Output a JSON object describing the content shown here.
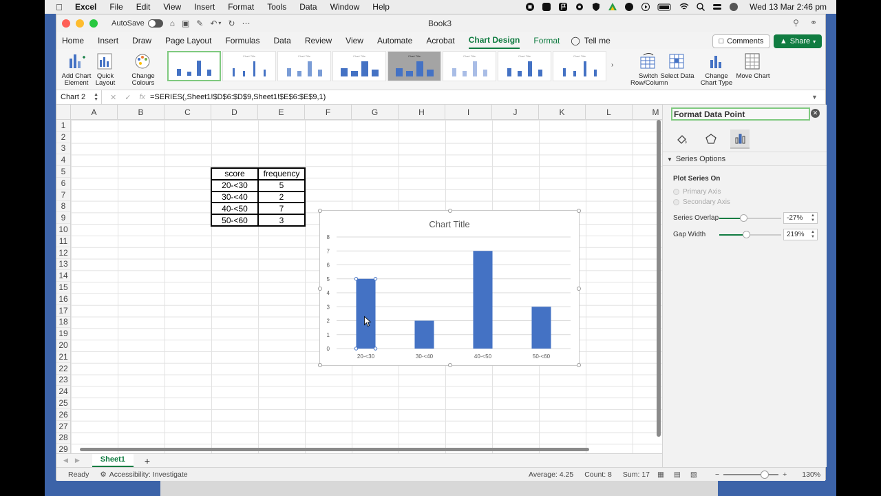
{
  "menubar": {
    "app": "Excel",
    "items": [
      "File",
      "Edit",
      "View",
      "Insert",
      "Format",
      "Tools",
      "Data",
      "Window",
      "Help"
    ],
    "clock": "Wed 13 Mar  2:46 pm"
  },
  "titlebar": {
    "autosave_label": "AutoSave",
    "doc_title": "Book3"
  },
  "tabs": [
    "Home",
    "Insert",
    "Draw",
    "Page Layout",
    "Formulas",
    "Data",
    "Review",
    "View",
    "Automate",
    "Acrobat",
    "Chart Design",
    "Format"
  ],
  "active_tab": "Chart Design",
  "tell_me": "Tell me",
  "comments_label": "Comments",
  "share_label": "Share",
  "ribbon": {
    "add_chart_element": "Add Chart Element",
    "quick_layout": "Quick Layout",
    "change_colours": "Change Colours",
    "switch_row_column": "Switch Row/Column",
    "select_data": "Select Data",
    "change_chart_type": "Change Chart Type",
    "move_chart": "Move Chart"
  },
  "formula_bar": {
    "name_box": "Chart 2",
    "formula": "=SERIES(,Sheet1!$D$6:$D$9,Sheet1!$E$6:$E$9,1)"
  },
  "columns": [
    "A",
    "B",
    "C",
    "D",
    "E",
    "F",
    "G",
    "H",
    "I",
    "J",
    "K",
    "L",
    "M"
  ],
  "rows": [
    "1",
    "2",
    "3",
    "4",
    "5",
    "6",
    "7",
    "8",
    "9",
    "10",
    "11",
    "12",
    "13",
    "14",
    "15",
    "16",
    "17",
    "18",
    "19",
    "20",
    "21",
    "22",
    "23",
    "24",
    "25",
    "26",
    "27",
    "28",
    "29"
  ],
  "table": {
    "headers": [
      "score",
      "frequency"
    ],
    "rows": [
      [
        "20-<30",
        "5"
      ],
      [
        "30-<40",
        "2"
      ],
      [
        "40-<50",
        "7"
      ],
      [
        "50-<60",
        "3"
      ]
    ]
  },
  "chart_data": {
    "type": "bar",
    "title": "Chart Title",
    "categories": [
      "20-<30",
      "30-<40",
      "40-<50",
      "50-<60"
    ],
    "values": [
      5,
      2,
      7,
      3
    ],
    "ylim": [
      0,
      8
    ],
    "yticks": [
      "0",
      "1",
      "2",
      "3",
      "4",
      "5",
      "6",
      "7",
      "8"
    ],
    "color": "#4472c4",
    "grid": true,
    "selected_index": 0
  },
  "sheet_tab": "Sheet1",
  "status": {
    "ready": "Ready",
    "accessibility": "Accessibility: Investigate",
    "average": "Average: 4.25",
    "count": "Count: 8",
    "sum": "Sum: 17",
    "zoom": "130%"
  },
  "pane": {
    "title": "Format Data Point",
    "section": "Series Options",
    "plot_series_on": "Plot Series On",
    "primary_axis": "Primary Axis",
    "secondary_axis": "Secondary Axis",
    "series_overlap_label": "Series Overlap",
    "series_overlap_value": "-27%",
    "gap_width_label": "Gap Width",
    "gap_width_value": "219%"
  }
}
